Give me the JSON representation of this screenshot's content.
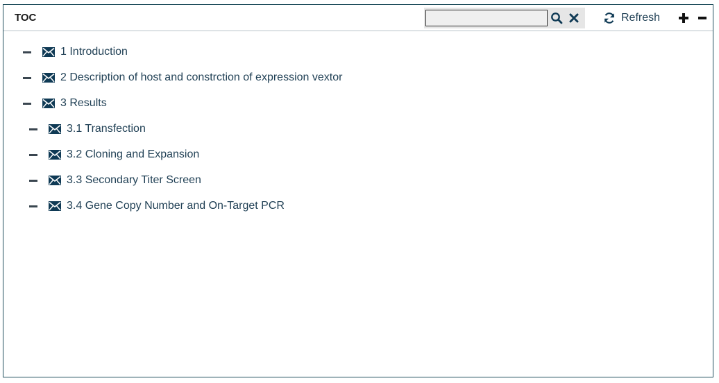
{
  "header": {
    "title": "TOC",
    "search_value": "",
    "refresh_label": "Refresh"
  },
  "tree": [
    {
      "label": "1 Introduction",
      "level": 1
    },
    {
      "label": "2 Description of host and constrction of expression vextor",
      "level": 1
    },
    {
      "label": "3 Results",
      "level": 1
    },
    {
      "label": "3.1 Transfection",
      "level": 2
    },
    {
      "label": "3.2 Cloning and Expansion",
      "level": 2
    },
    {
      "label": "3.3 Secondary Titer Screen",
      "level": 2
    },
    {
      "label": "3.4 Gene Copy Number and On-Target PCR",
      "level": 2
    }
  ],
  "colors": {
    "accent": "#0f3a55",
    "border": "#1f4d5c"
  }
}
